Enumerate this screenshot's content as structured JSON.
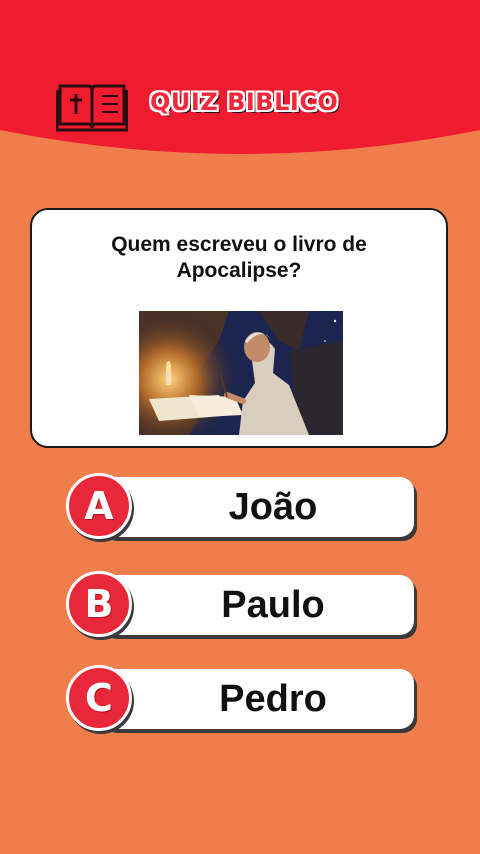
{
  "header": {
    "title": "QUIZ BIBLICO",
    "icon": "bible-book-icon",
    "color": "#ee1c2e"
  },
  "question": {
    "text": "Quem escreveu o livro de Apocalipse?",
    "image": "elderly-man-writing-by-candlelight-illustration"
  },
  "options": [
    {
      "letter": "A",
      "answer": "João"
    },
    {
      "letter": "B",
      "answer": "Paulo"
    },
    {
      "letter": "C",
      "answer": "Pedro"
    }
  ],
  "colors": {
    "background": "#f07e4c",
    "accent_red": "#e8283a",
    "card": "#ffffff"
  }
}
